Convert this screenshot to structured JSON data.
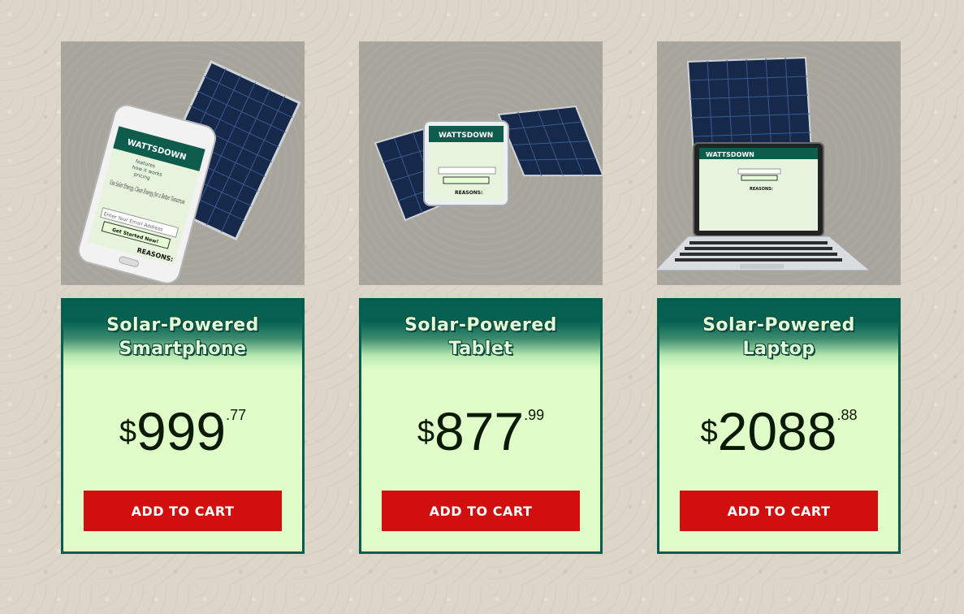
{
  "products": [
    {
      "title_line1": "Solar-Powered",
      "title_line2": "Smartphone",
      "currency": "$",
      "price_whole": "999",
      "price_cents": ".77",
      "button_label": "ADD TO CART",
      "image": {
        "brand": "WATTSDOWN",
        "menu": [
          "features",
          "how it works",
          "pricing"
        ],
        "tagline": "Use Solar Energy, Clean Energy for a Better Tomorrow.",
        "email_placeholder": "Enter Your Email Address",
        "cta": "Get Started Now!",
        "reasons": "REASONS:"
      }
    },
    {
      "title_line1": "Solar-Powered",
      "title_line2": "Tablet",
      "currency": "$",
      "price_whole": "877",
      "price_cents": ".99",
      "button_label": "ADD TO CART",
      "image": {
        "brand": "WATTSDOWN",
        "reasons": "REASONS:"
      }
    },
    {
      "title_line1": "Solar-Powered",
      "title_line2": "Laptop",
      "currency": "$",
      "price_whole": "2088",
      "price_cents": ".88",
      "button_label": "ADD TO CART",
      "image": {
        "brand": "WATTSDOWN",
        "reasons": "REASONS:"
      }
    }
  ],
  "colors": {
    "card_border": "#075e4f",
    "card_bg": "#e0fcc8",
    "button_bg": "#d20f0f",
    "image_bg": "#a8a59c"
  }
}
